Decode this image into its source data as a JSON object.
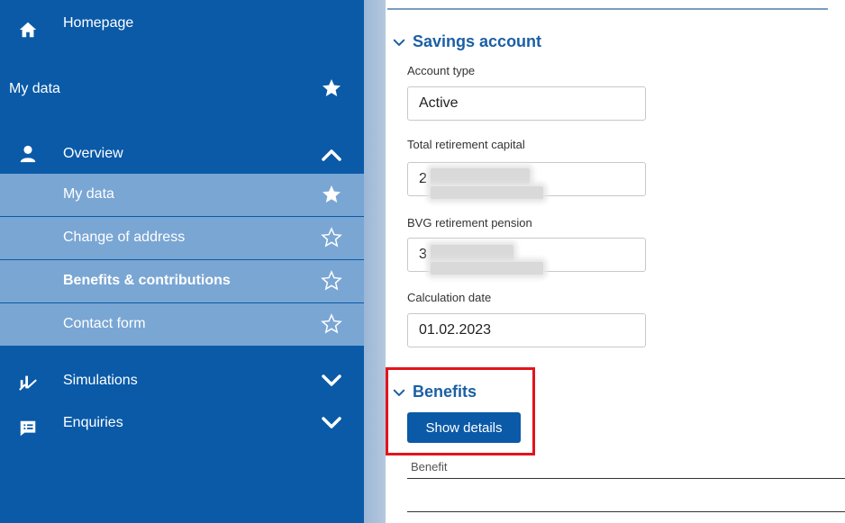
{
  "sidebar": {
    "homepage": "Homepage",
    "my_data_header": "My data",
    "overview": "Overview",
    "sub_items": [
      {
        "label": "My data",
        "starred": true,
        "bold": false
      },
      {
        "label": "Change of address",
        "starred": false,
        "bold": false
      },
      {
        "label": "Benefits & contributions",
        "starred": false,
        "bold": true
      },
      {
        "label": "Contact form",
        "starred": false,
        "bold": false
      }
    ],
    "simulations": "Simulations",
    "enquiries": "Enquiries"
  },
  "main": {
    "savings_title": "Savings account",
    "account_type_label": "Account type",
    "account_type_value": "Active",
    "total_capital_label": "Total retirement capital",
    "total_capital_value": "2",
    "bvg_pension_label": "BVG retirement pension",
    "bvg_pension_value": "3",
    "calc_date_label": "Calculation date",
    "calc_date_value": "01.02.2023",
    "benefits_title": "Benefits",
    "show_details_label": "Show details",
    "benefit_column_label": "Benefit"
  },
  "colors": {
    "sidebar_bg": "#0a5aa8",
    "sub_item_bg": "#7aa6d4",
    "accent": "#1b5fa5",
    "highlight": "#e3141b"
  }
}
